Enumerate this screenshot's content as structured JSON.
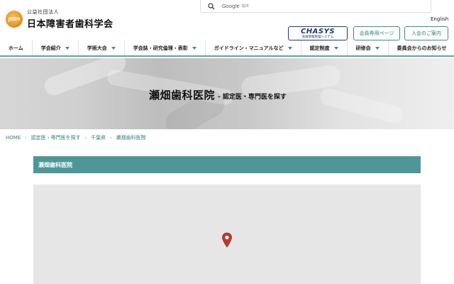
{
  "logo": {
    "sub": "公益社団法人",
    "main": "日本障害者歯科学会",
    "mark_text": "JSDH"
  },
  "search": {
    "brand": "Google",
    "placeholder": "提供"
  },
  "header": {
    "lang": "English",
    "chasys_title": "CHASYS",
    "chasys_sub": "会員情報管理システム",
    "member_page": "会員専用ページ",
    "join": "入会のご案内"
  },
  "nav": {
    "items": [
      {
        "label": "ホーム",
        "dropdown": false
      },
      {
        "label": "学会紹介",
        "dropdown": true
      },
      {
        "label": "学術大会",
        "dropdown": true
      },
      {
        "label": "学会誌・研究倫理・表彰",
        "dropdown": true
      },
      {
        "label": "ガイドライン・マニュアルなど",
        "dropdown": true
      },
      {
        "label": "認定制度",
        "dropdown": true
      },
      {
        "label": "研修会",
        "dropdown": true
      },
      {
        "label": "委員会からのお知らせ",
        "dropdown": false
      }
    ]
  },
  "hero": {
    "title": "瀬畑歯科医院",
    "subtitle": "- 認定医・専門医を探す"
  },
  "breadcrumb": {
    "items": [
      "HOME",
      "認定医・専門医を探す",
      "千葉県"
    ],
    "current": "瀬畑歯科医院"
  },
  "section": {
    "title": "瀬畑歯科医院"
  },
  "colors": {
    "accent": "#4e9797",
    "link": "#2d7d7d",
    "pin": "#c0392b",
    "chasys": "#1f3b6e"
  },
  "icons": [
    "search-icon",
    "map-pin-icon",
    "chevron-down-icon"
  ]
}
